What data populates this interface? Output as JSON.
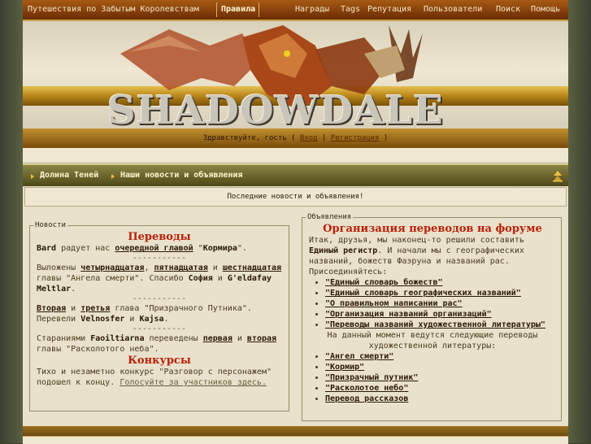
{
  "topnav": {
    "left": [
      "Путешествия по Забытым Королевствам",
      "Правила"
    ],
    "right": [
      "Награды",
      "Tags",
      "Репутация",
      "Пользователи",
      "Поиск",
      "Помощь"
    ]
  },
  "banner": {
    "logo": "SHADOWDALE"
  },
  "greeting": {
    "text": "Здравствуйте, гость",
    "login": "Вход",
    "register": "Регистрация"
  },
  "breadcrumb": [
    "Долина Теней",
    "Наши новости и объявления"
  ],
  "subtitle": "Последние новости и объявления!",
  "news": {
    "legend": "Новости",
    "translations_title": "Переводы",
    "p1": [
      "Bard",
      " радует нас ",
      "очередной главой",
      " \"",
      "Кормира",
      "\"."
    ],
    "dash": "-----------",
    "p2": [
      "Выложены ",
      "четырнадцатая",
      ", ",
      "пятнадцатая",
      " и ",
      "шестнадцатая",
      " главы \"Ангела смерти\". Спасибо ",
      "София",
      " и ",
      "G'eldafay Meltlar",
      "."
    ],
    "p3": [
      "Вторая",
      " и ",
      "третья",
      " глава \"Призрачного Путника\". Перевели ",
      "Velnosfer",
      " и ",
      "Kajsa",
      "."
    ],
    "p4": [
      "Стараниями ",
      "Faoiltiarna",
      " переведены ",
      "первая",
      " и ",
      "вторая",
      " главы \"Расколотого неба\"."
    ],
    "contests_title": "Конкурсы",
    "p5": [
      "Тихо и незаметно конкурс \"Разговор с персонажем\" подошел к концу. ",
      "Голосуйте за участников здесь."
    ]
  },
  "announcements": {
    "legend": "Объявления",
    "title": "Организация переводов на форуме",
    "intro_a": "Итак, друзья, мы наконец-то решили составить ",
    "intro_b": "Единый регистр",
    "intro_c": ". И начали мы с географических названий, божеств Фаэруна и названий рас. Присоединяйтесь:",
    "list1": [
      "\"Единый словарь божеств\"",
      "\"Единый словарь географических названий\"",
      "\"О правильном написании рас\"",
      "\"Организация названий организаций\"",
      "\"Переводы названий художественной литературы\""
    ],
    "middle": "На данный момент ведутся следующие переводы художественной литературы:",
    "list2": [
      "\"Ангел смерти\"",
      "\"Кормир\"",
      "\"Призрачный путник\"",
      "\"Расколотое небо\"",
      "Перевод рассказов"
    ]
  },
  "colors": {
    "accent_red": "#b8200a",
    "bar_brown": "#6a2c06",
    "nav_olive": "#4d4818"
  }
}
